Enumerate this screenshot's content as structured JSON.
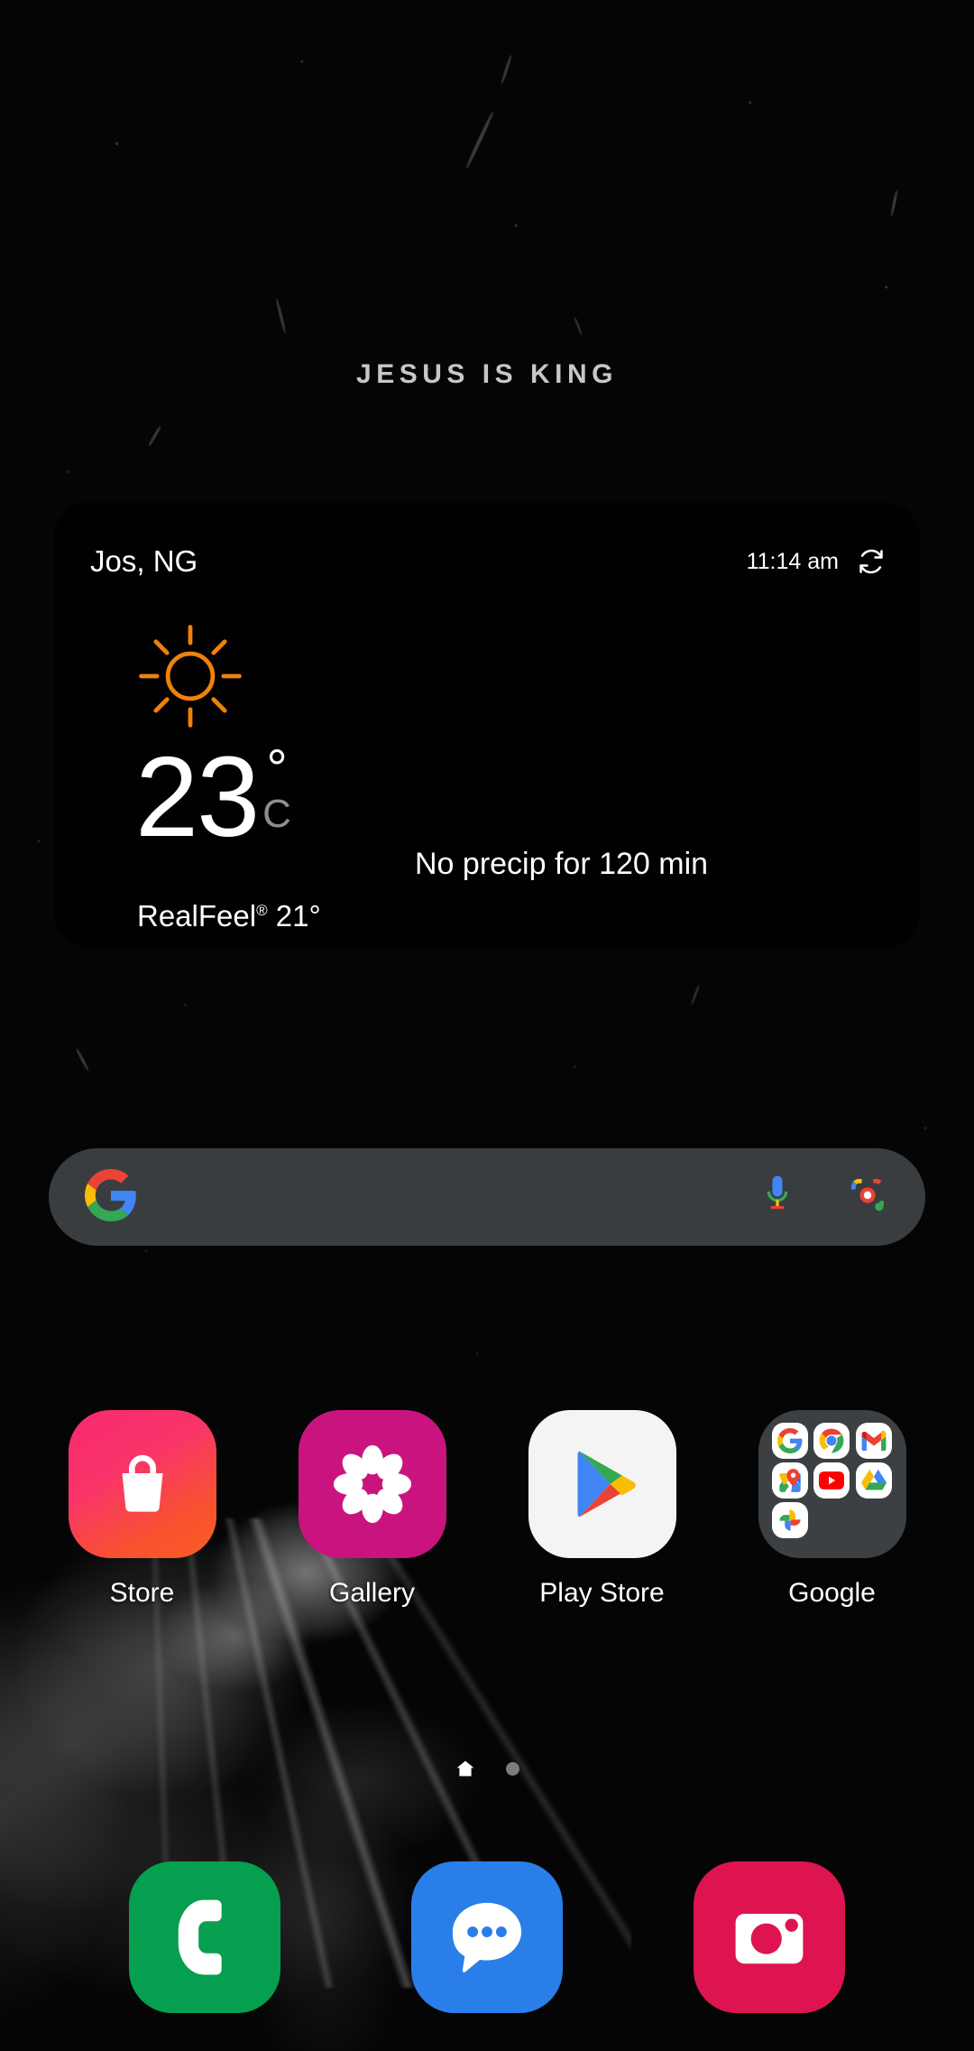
{
  "wallpaper": {
    "caption": "JESUS IS KING",
    "background_color": "#050505",
    "subject": "lion-photo"
  },
  "weather": {
    "location": "Jos, NG",
    "time": "11:14 am",
    "refresh_icon": "refresh-icon",
    "condition_icon": "sunny-icon",
    "condition_color": "#f07800",
    "temperature": "23",
    "degree_symbol": "°",
    "unit": "C",
    "realfeel_label": "RealFeel",
    "realfeel_mark": "®",
    "realfeel_value": "21°",
    "precip_text": "No precip for 120 min",
    "card_color": "#010101"
  },
  "search": {
    "logo_icon": "google-g-icon",
    "placeholder": "",
    "value": "",
    "mic_icon": "microphone-icon",
    "lens_icon": "google-lens-icon",
    "bar_color": "#393d40"
  },
  "apps": [
    {
      "label": "Store",
      "icon": "galaxy-store-icon"
    },
    {
      "label": "Gallery",
      "icon": "gallery-icon"
    },
    {
      "label": "Play Store",
      "icon": "play-store-icon"
    },
    {
      "label": "Google",
      "icon": "google-folder-icon"
    }
  ],
  "folder": {
    "name": "Google",
    "apps": [
      {
        "name": "Google"
      },
      {
        "name": "Chrome"
      },
      {
        "name": "Gmail"
      },
      {
        "name": "Maps"
      },
      {
        "name": "YouTube"
      },
      {
        "name": "Drive"
      },
      {
        "name": "Photos"
      }
    ]
  },
  "page_indicator": {
    "pages": 2,
    "current": 1
  },
  "dock": [
    {
      "label": "Phone",
      "icon": "phone-icon",
      "color": "#069e4f"
    },
    {
      "label": "Messages",
      "icon": "messages-icon",
      "color": "#2a7ee8"
    },
    {
      "label": "Camera",
      "icon": "camera-icon",
      "color": "#dd1450"
    }
  ]
}
